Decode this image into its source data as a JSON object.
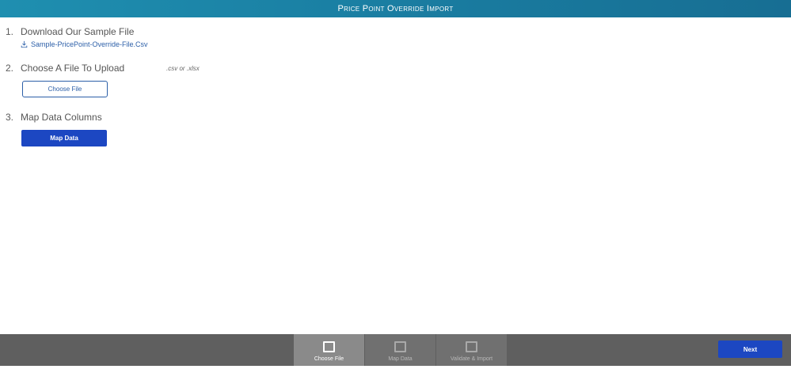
{
  "header": {
    "title": "Price Point Override Import"
  },
  "steps": [
    {
      "num": "1.",
      "label": "Download Our Sample File"
    },
    {
      "num": "2.",
      "label": "Choose A File To Upload"
    },
    {
      "num": "3.",
      "label": "Map Data Columns"
    }
  ],
  "download": {
    "link_text": "Sample-PricePoint-Override-File.Csv",
    "icon": "download-icon"
  },
  "upload": {
    "hint": ".csv or .xlsx",
    "choose_label": "Choose File"
  },
  "map": {
    "button_label": "Map Data"
  },
  "wizard": {
    "steps": [
      {
        "label": "Choose File",
        "state": "active"
      },
      {
        "label": "Map Data",
        "state": "inactive"
      },
      {
        "label": "Validate & Import",
        "state": "inactive"
      }
    ],
    "next_label": "Next"
  },
  "colors": {
    "header_gradient_start": "#1f8fb0",
    "header_gradient_end": "#176e93",
    "primary_button": "#1c47c2",
    "link": "#2c5fa8",
    "footer": "#5f5f5f"
  }
}
